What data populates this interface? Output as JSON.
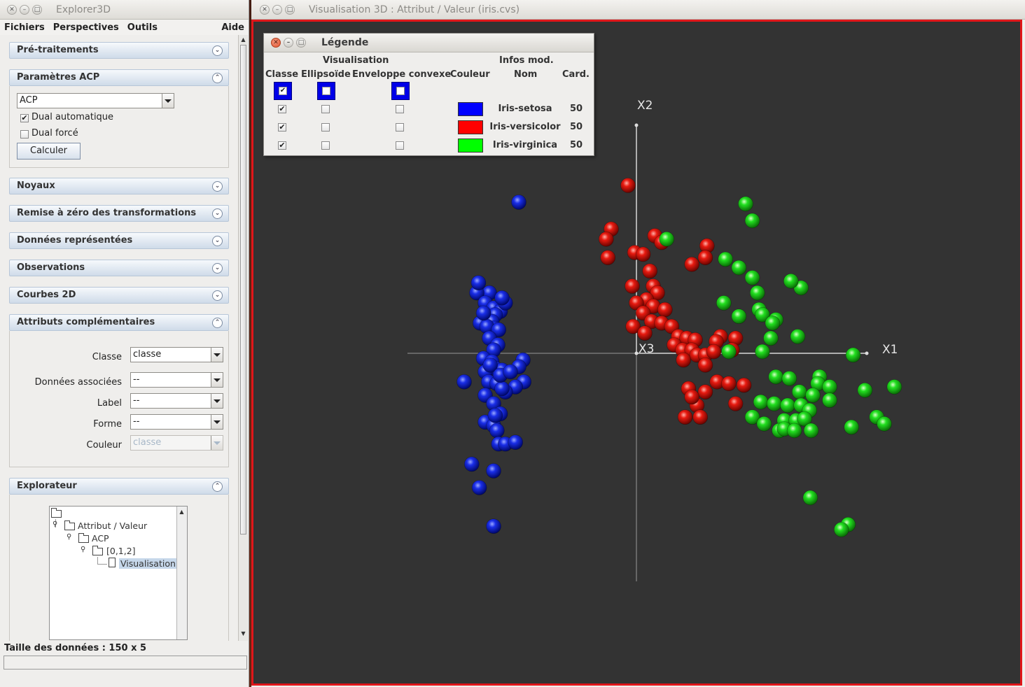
{
  "left_window": {
    "title": "Explorer3D",
    "menu": [
      "Fichiers",
      "Perspectives",
      "Outils"
    ],
    "menu_right": "Aide",
    "panels": {
      "pretraitements": "Pré-traitements",
      "parametres_acp": "Paramètres ACP",
      "noyaux": "Noyaux",
      "remise": "Remise à zéro des transformations",
      "donnees": "Données représentées",
      "observations": "Observations",
      "courbes": "Courbes 2D",
      "attributs": "Attributs complémentaires",
      "explorateur": "Explorateur"
    },
    "acp": {
      "method_value": "ACP",
      "dual_auto_label": "Dual automatique",
      "dual_auto_checked": true,
      "dual_force_label": "Dual forcé",
      "dual_force_checked": false,
      "calc_button": "Calculer"
    },
    "attributs": {
      "classe_label": "Classe",
      "classe_value": "classe",
      "donnees_label": "Données associées",
      "donnees_value": "--",
      "label_label": "Label",
      "label_value": "--",
      "forme_label": "Forme",
      "forme_value": "--",
      "couleur_label": "Couleur",
      "couleur_value": "classe"
    },
    "tree": {
      "root": "Attribut / Valeur",
      "child": "ACP",
      "grandchild": "[0,1,2]",
      "leaf": "Visualisation"
    },
    "status": "Taille des données : 150 x 5"
  },
  "right_window": {
    "title": "Visualisation 3D : Attribut / Valeur (iris.cvs)",
    "axes": {
      "x": "X1",
      "y": "X2",
      "z": "X3"
    }
  },
  "legend": {
    "title": "Légende",
    "group_vis": "Visualisation",
    "group_infos": "Infos mod.",
    "col_classe": "Classe",
    "col_ellipsoide": "Ellipsoïde",
    "col_enveloppe": "Enveloppe convexe",
    "col_couleur": "Couleur",
    "col_nom": "Nom",
    "col_card": "Card.",
    "rows": [
      {
        "name": "Iris-setosa",
        "card": "50",
        "color": "#0000ff",
        "classe": true,
        "ellipsoide": false,
        "enveloppe": false
      },
      {
        "name": "Iris-versicolor",
        "card": "50",
        "color": "#ff0000",
        "classe": true,
        "ellipsoide": false,
        "enveloppe": false
      },
      {
        "name": "Iris-virginica",
        "card": "50",
        "color": "#00ff00",
        "classe": true,
        "ellipsoide": false,
        "enveloppe": false
      }
    ]
  },
  "chart_data": {
    "type": "scatter",
    "xlabel": "X1",
    "ylabel": "X2",
    "origin_label": "X3",
    "xlim": [
      -2.75,
      2.75
    ],
    "ylim": [
      -2.75,
      2.75
    ],
    "series": [
      {
        "name": "Iris-setosa",
        "color": "#0000ff",
        "points": [
          [
            -1.4,
            1.8
          ],
          [
            -1.75,
            0.72
          ],
          [
            -1.9,
            0.72
          ],
          [
            -1.8,
            0.6
          ],
          [
            -1.7,
            0.54
          ],
          [
            -1.62,
            0.5
          ],
          [
            -1.68,
            0.46
          ],
          [
            -1.72,
            0.38
          ],
          [
            -1.86,
            0.36
          ],
          [
            -1.7,
            0.3
          ],
          [
            -1.78,
            0.32
          ],
          [
            -1.64,
            0.28
          ],
          [
            -1.75,
            0.18
          ],
          [
            -1.65,
            0.1
          ],
          [
            -1.7,
            0.04
          ],
          [
            -1.82,
            -0.06
          ],
          [
            -1.72,
            -0.1
          ],
          [
            -1.68,
            -0.18
          ],
          [
            -1.35,
            -0.08
          ],
          [
            -1.4,
            -0.16
          ],
          [
            -1.6,
            -0.2
          ],
          [
            -1.8,
            -0.22
          ],
          [
            -2.05,
            -0.34
          ],
          [
            -1.76,
            -0.34
          ],
          [
            -1.66,
            -0.36
          ],
          [
            -1.34,
            -0.34
          ],
          [
            -1.44,
            -0.4
          ],
          [
            -1.56,
            -0.46
          ],
          [
            -1.8,
            -0.5
          ],
          [
            -1.7,
            -0.6
          ],
          [
            -1.62,
            -0.72
          ],
          [
            -1.8,
            -0.82
          ],
          [
            -1.7,
            -0.86
          ],
          [
            -1.66,
            -0.92
          ],
          [
            -1.64,
            -1.08
          ],
          [
            -1.56,
            -1.08
          ],
          [
            -1.44,
            -1.06
          ],
          [
            -1.96,
            -1.32
          ],
          [
            -1.7,
            -1.4
          ],
          [
            -1.87,
            -1.6
          ],
          [
            -1.7,
            -2.06
          ],
          [
            -1.88,
            0.84
          ],
          [
            -1.56,
            0.6
          ],
          [
            -1.6,
            -0.42
          ],
          [
            -1.74,
            -0.14
          ],
          [
            -1.62,
            -0.26
          ],
          [
            -1.82,
            0.48
          ],
          [
            -1.68,
            -0.74
          ],
          [
            -1.6,
            0.66
          ],
          [
            -1.5,
            -0.22
          ]
        ]
      },
      {
        "name": "Iris-versicolor",
        "color": "#ff0000",
        "points": [
          [
            -0.1,
            2.0
          ],
          [
            -0.3,
            1.48
          ],
          [
            -0.36,
            1.36
          ],
          [
            -0.34,
            1.14
          ],
          [
            0.22,
            1.4
          ],
          [
            0.3,
            1.32
          ],
          [
            -0.02,
            1.2
          ],
          [
            0.08,
            1.18
          ],
          [
            0.84,
            1.28
          ],
          [
            0.82,
            1.14
          ],
          [
            0.66,
            1.06
          ],
          [
            0.16,
            0.98
          ],
          [
            0.2,
            0.8
          ],
          [
            -0.05,
            0.8
          ],
          [
            0.25,
            0.72
          ],
          [
            0.12,
            0.64
          ],
          [
            0.0,
            0.6
          ],
          [
            0.2,
            0.56
          ],
          [
            0.34,
            0.52
          ],
          [
            0.08,
            0.48
          ],
          [
            0.18,
            0.38
          ],
          [
            0.3,
            0.36
          ],
          [
            0.42,
            0.32
          ],
          [
            -0.04,
            0.32
          ],
          [
            0.1,
            0.24
          ],
          [
            0.5,
            0.2
          ],
          [
            0.6,
            0.18
          ],
          [
            0.7,
            0.16
          ],
          [
            1.0,
            0.2
          ],
          [
            0.95,
            0.14
          ],
          [
            1.18,
            0.18
          ],
          [
            0.45,
            0.1
          ],
          [
            0.55,
            0.04
          ],
          [
            0.66,
            0.04
          ],
          [
            0.72,
            -0.02
          ],
          [
            0.82,
            -0.02
          ],
          [
            0.92,
            0.02
          ],
          [
            1.14,
            0.04
          ],
          [
            0.56,
            -0.08
          ],
          [
            0.82,
            -0.14
          ],
          [
            0.96,
            -0.34
          ],
          [
            1.1,
            -0.36
          ],
          [
            0.62,
            -0.42
          ],
          [
            0.72,
            -0.62
          ],
          [
            0.76,
            -0.76
          ],
          [
            0.58,
            -0.76
          ],
          [
            0.82,
            -0.46
          ],
          [
            1.18,
            -0.6
          ],
          [
            0.66,
            -0.52
          ],
          [
            1.28,
            -0.38
          ]
        ]
      },
      {
        "name": "Iris-virginica",
        "color": "#00ff00",
        "points": [
          [
            1.3,
            1.78
          ],
          [
            1.38,
            1.58
          ],
          [
            0.36,
            1.36
          ],
          [
            1.06,
            1.12
          ],
          [
            1.22,
            1.02
          ],
          [
            1.38,
            0.9
          ],
          [
            1.96,
            0.78
          ],
          [
            1.84,
            0.86
          ],
          [
            1.44,
            0.72
          ],
          [
            1.04,
            0.6
          ],
          [
            1.46,
            0.52
          ],
          [
            1.5,
            0.46
          ],
          [
            1.22,
            0.44
          ],
          [
            1.66,
            0.4
          ],
          [
            1.62,
            0.36
          ],
          [
            1.92,
            0.2
          ],
          [
            1.6,
            0.18
          ],
          [
            1.1,
            0.02
          ],
          [
            1.5,
            0.02
          ],
          [
            2.58,
            -0.02
          ],
          [
            1.66,
            -0.28
          ],
          [
            1.82,
            -0.3
          ],
          [
            2.18,
            -0.28
          ],
          [
            2.16,
            -0.36
          ],
          [
            2.3,
            -0.4
          ],
          [
            1.94,
            -0.46
          ],
          [
            2.1,
            -0.5
          ],
          [
            1.48,
            -0.58
          ],
          [
            1.64,
            -0.6
          ],
          [
            1.8,
            -0.62
          ],
          [
            1.96,
            -0.62
          ],
          [
            2.06,
            -0.68
          ],
          [
            2.72,
            -0.44
          ],
          [
            2.3,
            -0.56
          ],
          [
            1.38,
            -0.76
          ],
          [
            1.52,
            -0.84
          ],
          [
            1.76,
            -0.8
          ],
          [
            1.9,
            -0.8
          ],
          [
            2.0,
            -0.78
          ],
          [
            2.56,
            -0.88
          ],
          [
            1.7,
            -0.92
          ],
          [
            1.76,
            -0.9
          ],
          [
            1.88,
            -0.92
          ],
          [
            2.08,
            -0.92
          ],
          [
            3.07,
            -0.4
          ],
          [
            2.86,
            -0.76
          ],
          [
            2.95,
            -0.84
          ],
          [
            2.07,
            -1.72
          ],
          [
            2.52,
            -2.04
          ],
          [
            2.44,
            -2.1
          ]
        ]
      }
    ]
  }
}
